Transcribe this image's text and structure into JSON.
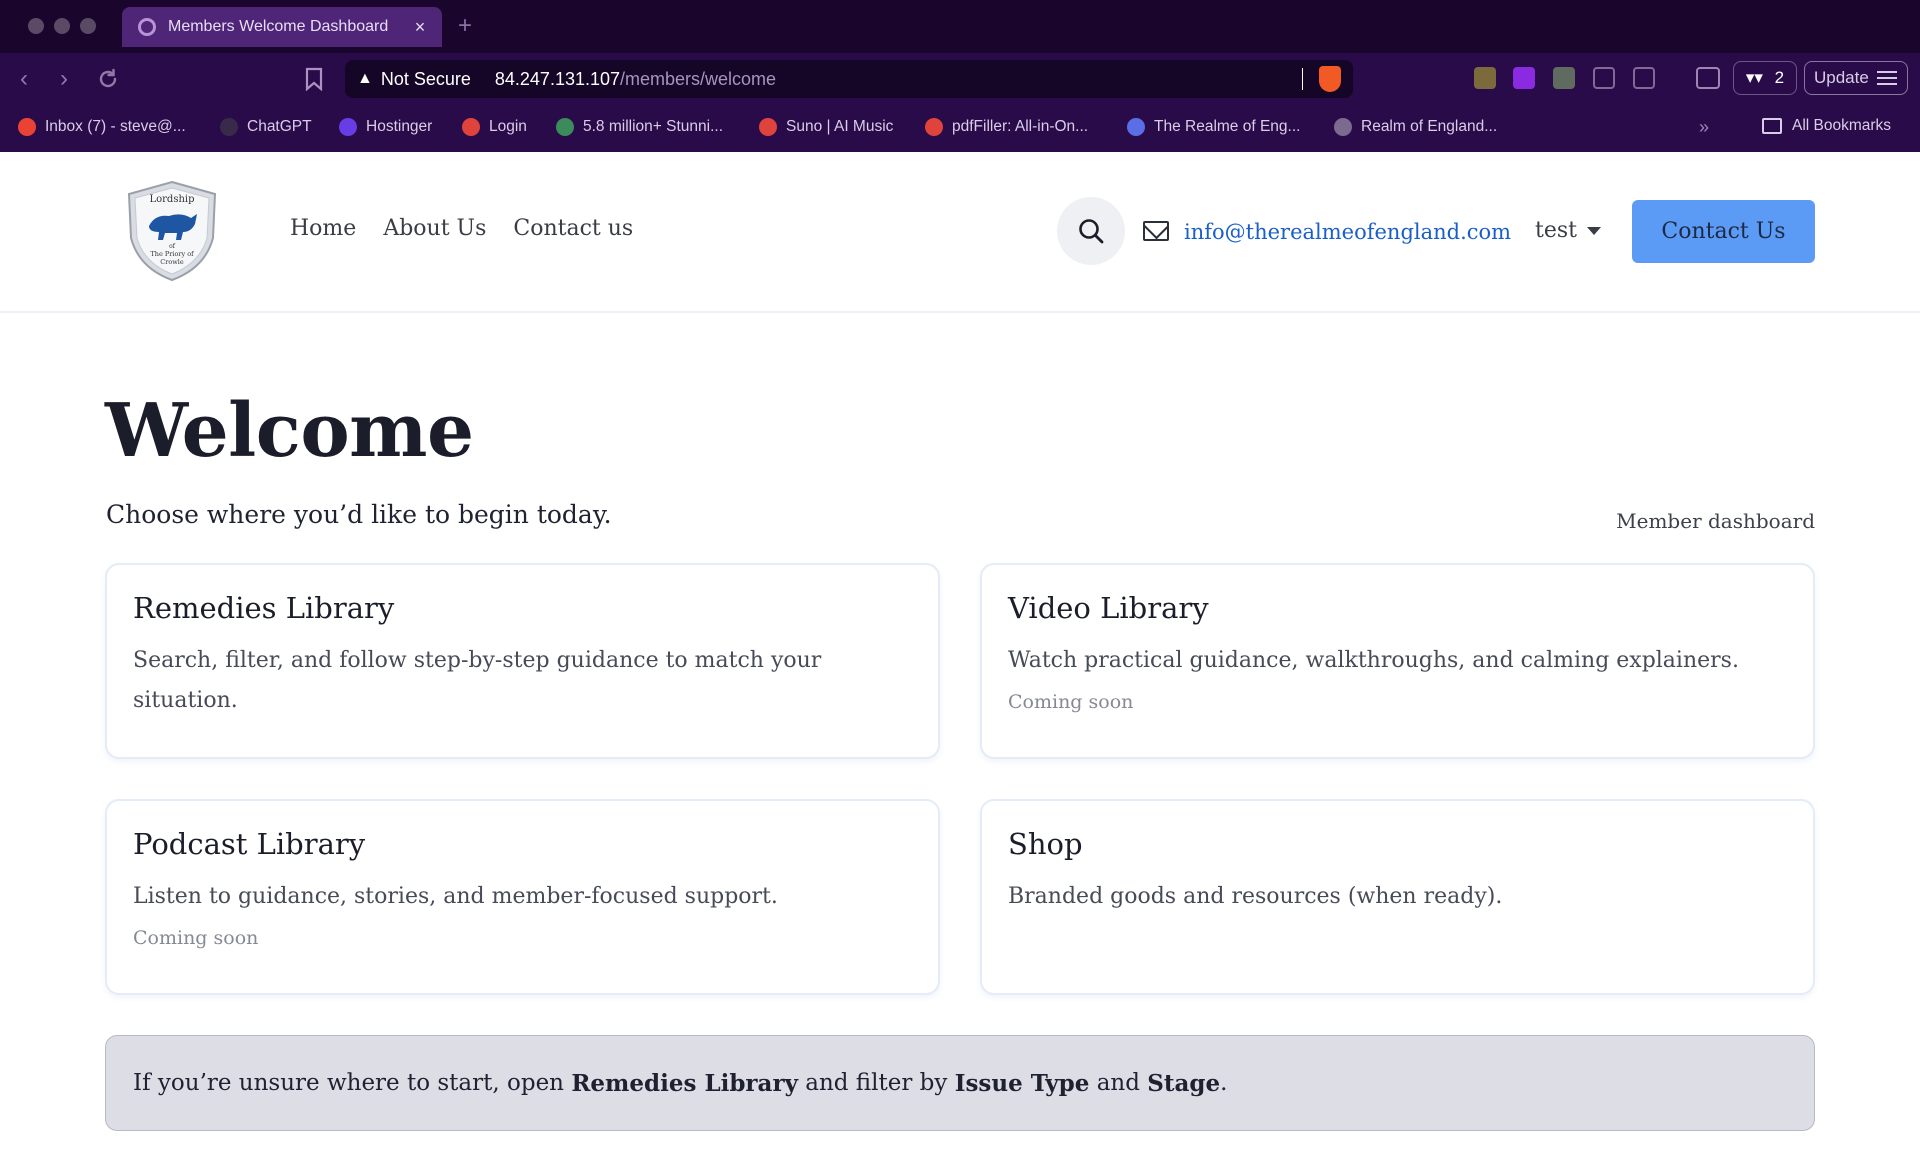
{
  "browser": {
    "tab_title": "Members Welcome Dashboard",
    "tab_close": "×",
    "new_tab": "+",
    "security_label": "Not Secure",
    "url_host": "84.247.131.107",
    "url_path": "/members/welcome",
    "wallet_count": "2",
    "update_label": "Update",
    "bookmarks": [
      {
        "label": "Inbox (7) - steve@...",
        "icon_color": "#ea4335"
      },
      {
        "label": "ChatGPT",
        "icon_color": "#3a2a4a"
      },
      {
        "label": "Hostinger",
        "icon_color": "#673de6"
      },
      {
        "label": "Login",
        "icon_color": "#e0433b"
      },
      {
        "label": "5.8 million+ Stunni...",
        "icon_color": "#3b8c5a"
      },
      {
        "label": "Suno | AI Music",
        "icon_color": "#e0433b"
      },
      {
        "label": "pdfFiller: All-in-On...",
        "icon_color": "#e0433b"
      },
      {
        "label": "The Realme of Eng...",
        "icon_color": "#5b6ee6"
      },
      {
        "label": "Realm of England...",
        "icon_color": "#7e6a8e"
      }
    ],
    "bookmarks_more": "»",
    "all_bookmarks": "All Bookmarks"
  },
  "site": {
    "logo_text": [
      "Lordship",
      "of",
      "The Priory of",
      "Crowle"
    ],
    "nav": [
      "Home",
      "About Us",
      "Contact us"
    ],
    "email": "info@therealmeofengland.com",
    "user": "test",
    "contact_button": "Contact Us"
  },
  "main": {
    "title": "Welcome",
    "lead": "Choose where you’d like to begin today.",
    "dashboard_link": "Member dashboard",
    "cards": [
      {
        "title": "Remedies Library",
        "description": "Search, filter, and follow step-by-step guidance to match your situation.",
        "status": ""
      },
      {
        "title": "Video Library",
        "description": "Watch practical guidance, walkthroughs, and calming explainers.",
        "status": "Coming soon"
      },
      {
        "title": "Podcast Library",
        "description": "Listen to guidance, stories, and member-focused support.",
        "status": "Coming soon"
      },
      {
        "title": "Shop",
        "description": "Branded goods and resources (when ready).",
        "status": ""
      }
    ],
    "tip": {
      "t1": "If you’re unsure where to start, open ",
      "b1": "Remedies Library",
      "t2": " and filter by ",
      "b2": "Issue Type",
      "t3": " and ",
      "b3": "Stage",
      "t4": "."
    }
  },
  "colors": {
    "chrome": "#22093b",
    "accent": "#5b9bf5",
    "link": "#1a5fc9"
  }
}
